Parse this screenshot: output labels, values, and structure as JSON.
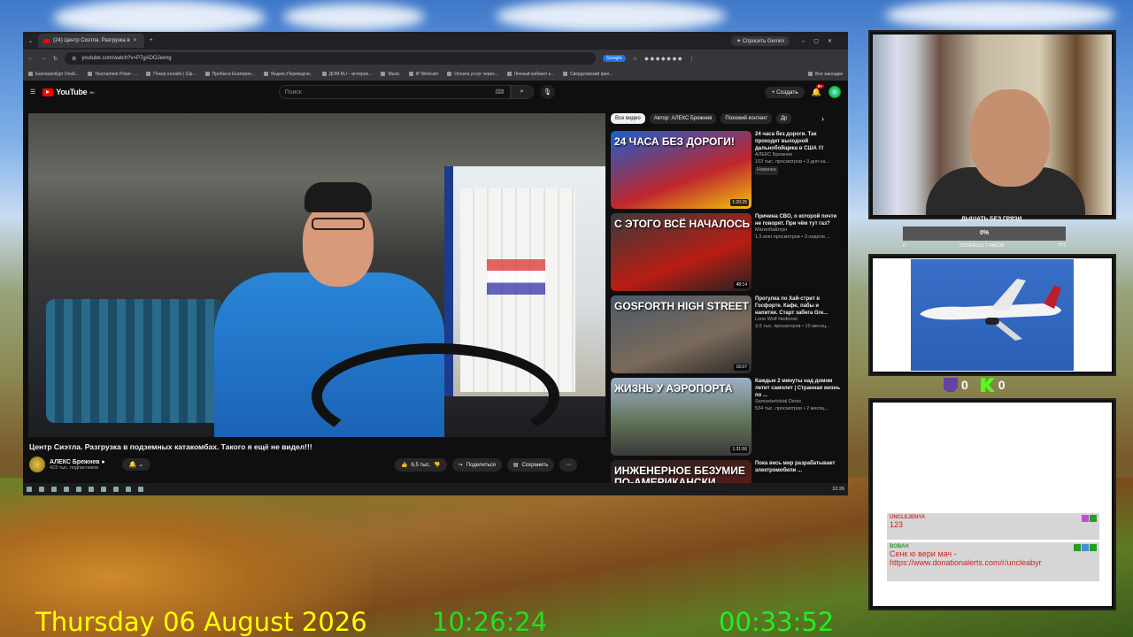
{
  "browser": {
    "tab_title": "(24) Центр Сиэтла. Разгрузка в",
    "gemini_label": "Спросить Gemini",
    "url": "youtube.com/watch?v=P7gADOJeimg",
    "google_label": "Google",
    "bookmarks": [
      "Екатеринбург Очаб...",
      "Tournament Poker -...",
      "Покер онлайн | Gip...",
      "Пробки в Екатерин...",
      "Яндекс.Переводчи...",
      "ДОМ.RU – интерне...",
      "Music",
      "IP Webcam",
      "Оплата услуг через...",
      "Личный кабинет к...",
      "Свердловский фил...",
      "Все закладки"
    ]
  },
  "youtube": {
    "logo": "YouTube",
    "logo_region": "RU",
    "search_placeholder": "Поиск",
    "create_label": "+ Создать",
    "notif_count": "9+",
    "video_title": "Центр Сиэтла. Разгрузка в подземных катакомбах. Такого я ещё не видел!!!",
    "channel_name": "АЛЕКС Брежнев",
    "subscribers": "423 тыс. подписчиков",
    "likes": "6,5 тыс.",
    "share_label": "Поделиться",
    "save_label": "Сохранить",
    "chips": [
      "Все видео",
      "Автор: АЛЕКС Брежнев",
      "Похожий контент",
      "Др"
    ],
    "recs": [
      {
        "title": "24 часа без дороги. Так проходит выходной дальнобойщика в США !!!",
        "channel": "АЛЕКС Брежнев",
        "views": "103 тыс. просмотров • 3 дня на...",
        "badge": "Новинка",
        "duration": "1:20:25",
        "overlay": "24 ЧАСА БЕЗ ДОРОГИ!"
      },
      {
        "title": "Причина СВО, о которой почти не говорят. При чём тут газ?",
        "channel": "Магилбайзтрн",
        "views": "1,5 млн просмотров • 3 недели ...",
        "badge": "",
        "duration": "48:14",
        "overlay": "С ЭТОГО ВСЁ НАЧАЛОСЬ"
      },
      {
        "title": "Прогулка по Хай-стрит в Госфорте. Кафе, пабы и напитки. Старт забега Gre...",
        "channel": "Lone Wolf Hedonist",
        "views": "3,6 тыс. просмотров • 10 месяц...",
        "badge": "",
        "duration": "16:07",
        "overlay": "GOSFORTH HIGH STREET"
      },
      {
        "title": "Каждые 2 минуты над домом летит самолет | Странная жизнь по ...",
        "channel": "Samsebetoktal Denis",
        "views": "534 тыс. просмотров • 2 месяц...",
        "badge": "",
        "duration": "1:31:56",
        "overlay": "ЖИЗНЬ У АЭРОПОРТА"
      },
      {
        "title": "Пока весь мир разрабатывает электромобили ...",
        "channel": "",
        "views": "",
        "badge": "",
        "duration": "",
        "overlay": "ИНЖЕНЕРНОЕ БЕЗУМИЕ ПО-АМЕРИКАНСКИ"
      }
    ]
  },
  "taskbar": {
    "time": "10:26"
  },
  "stream": {
    "goal_title": "ДЫШАТЬ БЕЗ ГРЯЗИ",
    "goal_percent": "0%",
    "goal_progress": 0,
    "goal_min": "0",
    "goal_remaining": "ОСТАЛОСЬ 7 ЧАСОВ",
    "goal_max": "???",
    "twitch_count": "0",
    "kick_count": "0",
    "chat": [
      {
        "user": "UNCLEJENYA",
        "text": "123",
        "color": "red"
      },
      {
        "user": "ВОВАН",
        "text": "Сенк ю вери мач - https://www.donationalerts.com/r/uncleabyr",
        "color": "green"
      }
    ],
    "date_text": "Thursday 06 August 2026",
    "clock_text": "10:26:24",
    "uptime_text": "00:33:52",
    "colors": {
      "date": "#ffff00",
      "clock": "#22dd22",
      "uptime": "#22ee22"
    }
  }
}
